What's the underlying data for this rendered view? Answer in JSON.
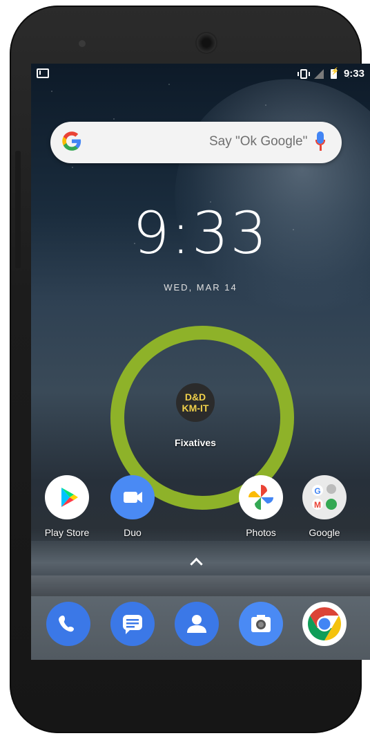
{
  "status_bar": {
    "time": "9:33"
  },
  "search": {
    "logo": "G",
    "hint": "Say \"Ok Google\""
  },
  "clock": {
    "time": "9:33",
    "date": "WED, MAR 14"
  },
  "highlighted_app": {
    "icon_line1": "D&D",
    "icon_line2": "KM-IT",
    "label": "Fixatives",
    "ring_color": "#8eb229"
  },
  "home_apps": [
    {
      "label": "Play Store",
      "icon": "play-store-icon"
    },
    {
      "label": "Duo",
      "icon": "duo-icon"
    },
    {
      "label": "Photos",
      "icon": "photos-icon"
    },
    {
      "label": "Google",
      "icon": "google-folder-icon"
    }
  ],
  "dock": [
    {
      "icon": "phone-icon"
    },
    {
      "icon": "messages-icon"
    },
    {
      "icon": "contacts-icon"
    },
    {
      "icon": "camera-icon"
    },
    {
      "icon": "chrome-icon"
    }
  ]
}
